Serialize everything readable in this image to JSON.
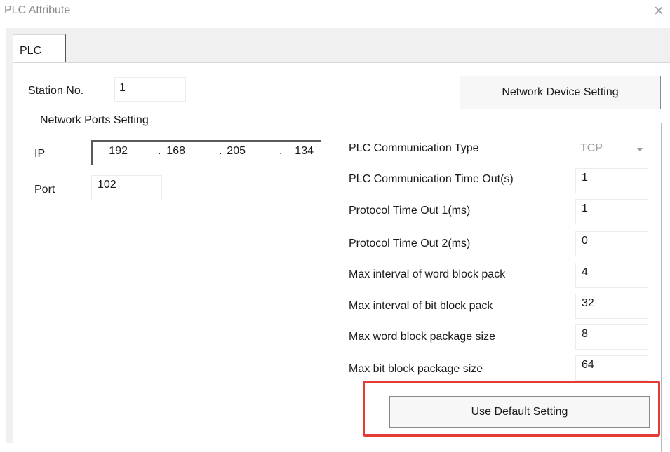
{
  "dialog": {
    "title": "PLC Attribute",
    "close_glyph": "×"
  },
  "tabs": [
    {
      "label": "PLC"
    }
  ],
  "station": {
    "label": "Station No.",
    "value": "1"
  },
  "network_device_button": "Network Device Setting",
  "network_ports": {
    "legend": "Network Ports Setting",
    "ip_label": "IP",
    "ip_octets": [
      "192",
      "168",
      "205",
      "134"
    ],
    "ip_separator": ".",
    "port_label": "Port",
    "port_value": "102"
  },
  "comm_type": {
    "label": "PLC Communication Type",
    "value": "TCP"
  },
  "settings": [
    {
      "label": "PLC Communication Time Out(s)",
      "value": "1"
    },
    {
      "label": "Protocol Time Out 1(ms)",
      "value": "1"
    },
    {
      "label": "Protocol Time Out 2(ms)",
      "value": "0"
    },
    {
      "label": "Max interval of word block pack",
      "value": "4"
    },
    {
      "label": "Max interval of bit block pack",
      "value": "32"
    },
    {
      "label": "Max word block package size",
      "value": "8"
    },
    {
      "label": "Max bit block package size",
      "value": "64"
    }
  ],
  "default_button": "Use Default Setting",
  "colors": {
    "highlight": "#e53a36",
    "panel_bg": "#f0f0f0"
  },
  "icons": {
    "close": "close-icon",
    "dropdown": "chevron-down-icon"
  }
}
